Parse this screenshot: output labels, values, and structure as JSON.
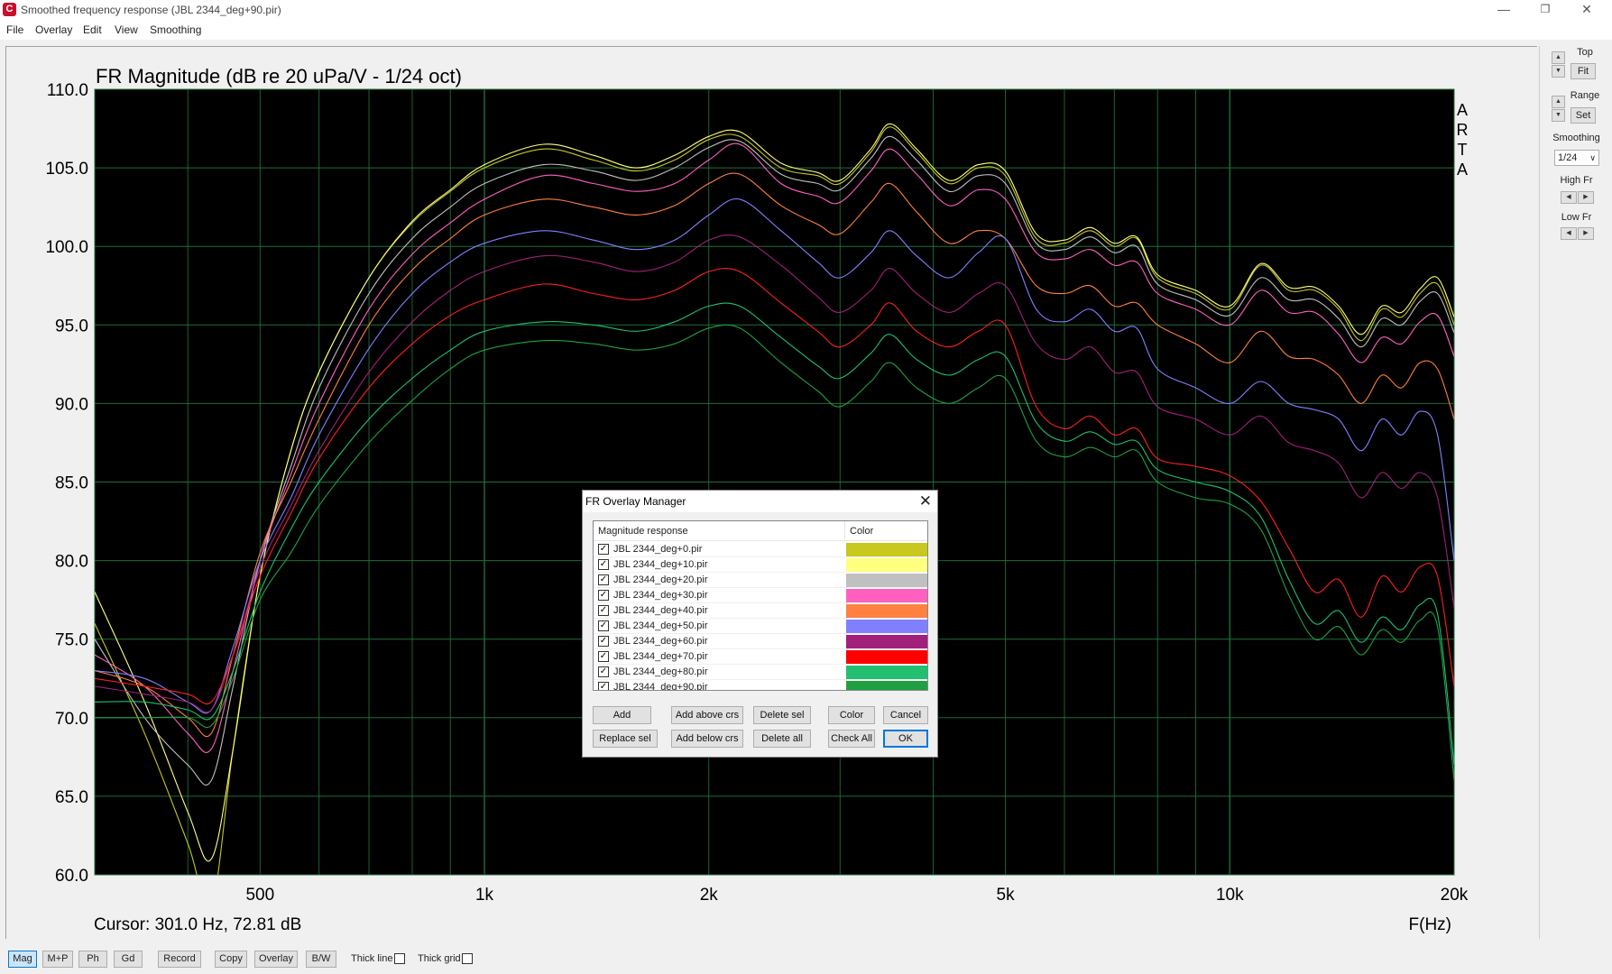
{
  "window": {
    "icon_letter": "C",
    "title": "Smoothed frequency response (JBL 2344_deg+90.pir)",
    "minimize_icon": "minimize-icon",
    "maximize_icon": "restore-icon",
    "close_icon": "close-icon"
  },
  "menu": [
    "File",
    "Overlay",
    "Edit",
    "View",
    "Smoothing"
  ],
  "plot": {
    "title": "FR Magnitude (dB re 20 uPa/V - 1/24 oct)",
    "side_logo": [
      "A",
      "R",
      "T",
      "A"
    ],
    "cursor_readout": "Cursor: 301.0 Hz, 72.81 dB",
    "xlabel": "F(Hz)"
  },
  "chart_data": {
    "type": "line",
    "title": "FR Magnitude (dB re 20 uPa/V - 1/24 oct)",
    "xlabel": "F(Hz)",
    "ylabel": "",
    "x_scale": "log",
    "xlim": [
      300,
      20000
    ],
    "ylim": [
      60,
      110
    ],
    "x_ticks": [
      {
        "value": 500,
        "label": "500"
      },
      {
        "value": 1000,
        "label": "1k"
      },
      {
        "value": 2000,
        "label": "2k"
      },
      {
        "value": 5000,
        "label": "5k"
      },
      {
        "value": 10000,
        "label": "10k"
      },
      {
        "value": 20000,
        "label": "20k"
      }
    ],
    "y_ticks": [
      "110.0",
      "105.0",
      "100.0",
      "95.0",
      "90.0",
      "85.0",
      "80.0",
      "75.0",
      "70.0",
      "65.0",
      "60.0"
    ],
    "grid": true,
    "background": "#000000",
    "grid_color": "#1e6e3a",
    "x": [
      300,
      350,
      400,
      430,
      460,
      500,
      550,
      600,
      700,
      800,
      900,
      1000,
      1200,
      1400,
      1600,
      1800,
      2000,
      2200,
      2500,
      2800,
      3000,
      3300,
      3500,
      3800,
      4200,
      4600,
      5000,
      5500,
      6000,
      6500,
      7000,
      7500,
      8000,
      9000,
      10000,
      11000,
      12000,
      13000,
      14000,
      15000,
      16000,
      17000,
      18000,
      19000,
      20000
    ],
    "series": [
      {
        "name": "JBL 2344_deg+0.pir",
        "color": "#c8c81e",
        "values": [
          76,
          69,
          62,
          58,
          68,
          79,
          87,
          92,
          98,
          101.5,
          103.5,
          105,
          106.2,
          105.5,
          104.8,
          105.5,
          106.8,
          107,
          105,
          104.5,
          104,
          106,
          107.6,
          106,
          104,
          105,
          104.5,
          100.5,
          100.2,
          101,
          100,
          100.5,
          98,
          97,
          96,
          98.8,
          97.2,
          97.2,
          96,
          94,
          96,
          95.5,
          97,
          97.6,
          95
        ]
      },
      {
        "name": "JBL 2344_deg+10.pir",
        "color": "#ffff80",
        "values": [
          78,
          71,
          64,
          61,
          68,
          79,
          87,
          92,
          98,
          101.6,
          103.6,
          105.2,
          106.5,
          105.8,
          105,
          105.8,
          107,
          107.3,
          105.3,
          104.7,
          104.2,
          106.2,
          107.8,
          106.2,
          104.2,
          105.2,
          104.8,
          100.8,
          100.4,
          101.2,
          100.2,
          100.6,
          98.2,
          97.2,
          96.2,
          98.9,
          97.4,
          97.4,
          96.2,
          94.4,
          96.2,
          95.8,
          97.3,
          98,
          95.5
        ]
      },
      {
        "name": "JBL 2344_deg+20.pir",
        "color": "#c0c0c0",
        "values": [
          75,
          70,
          67,
          66,
          72,
          80,
          86,
          91,
          97,
          100.5,
          102.5,
          104,
          105.2,
          104.8,
          104.2,
          105,
          106.3,
          106.7,
          104.6,
          104,
          103.6,
          105.6,
          107,
          105.5,
          103.5,
          104.5,
          104,
          100.2,
          99.8,
          100.6,
          99.6,
          100,
          97.6,
          96.6,
          95.6,
          98,
          96.6,
          96.6,
          95.4,
          93.6,
          95.4,
          95,
          96.5,
          97,
          94.5
        ]
      },
      {
        "name": "JBL 2344_deg+30.pir",
        "color": "#ff60c0",
        "values": [
          74,
          72,
          69,
          68,
          73,
          80,
          85.5,
          90,
          96,
          99.5,
          101.5,
          103,
          104.5,
          104,
          103.5,
          104,
          105.5,
          106.5,
          104,
          103.2,
          102.8,
          104.8,
          106.2,
          104.6,
          102.6,
          103.6,
          103,
          99.6,
          99.2,
          99.8,
          98.8,
          99,
          97,
          96,
          95,
          97.2,
          95.8,
          95.8,
          94.4,
          92.6,
          94.2,
          93.8,
          95.2,
          95.6,
          93
        ]
      },
      {
        "name": "JBL 2344_deg+40.pir",
        "color": "#ff8040",
        "values": [
          73,
          72,
          70,
          69,
          74,
          80.5,
          85,
          89,
          95,
          98.5,
          100.5,
          102,
          103,
          102.5,
          102,
          102.6,
          104,
          104.6,
          102.6,
          101.4,
          100.8,
          102.8,
          104,
          102.2,
          100.2,
          101,
          100.5,
          97.5,
          97,
          97.5,
          96.2,
          96.4,
          95,
          93.8,
          92.6,
          94.6,
          93,
          92.8,
          91.8,
          90,
          91.8,
          91,
          92.6,
          92.2,
          89
        ]
      },
      {
        "name": "JBL 2344_deg+50.pir",
        "color": "#8080ff",
        "values": [
          73,
          72.5,
          71,
          70.5,
          74.5,
          80,
          84,
          88,
          93.5,
          97,
          99,
          100.2,
          101,
          100.4,
          99.8,
          100.4,
          102,
          103,
          101,
          99,
          98,
          99.6,
          101,
          99.4,
          98,
          99.6,
          100.5,
          96,
          95.2,
          96,
          94.6,
          94.8,
          92.2,
          91,
          90,
          91.4,
          90,
          89.6,
          89,
          87,
          89,
          88,
          89.5,
          88,
          80
        ]
      },
      {
        "name": "JBL 2344_deg+60.pir",
        "color": "#a0207a",
        "values": [
          72,
          71.5,
          71,
          70.5,
          74,
          79.5,
          83.5,
          87,
          92,
          95.2,
          97.2,
          98.4,
          99.4,
          99,
          98.4,
          99,
          100.4,
          100.6,
          98.8,
          96.8,
          95.8,
          97.2,
          98.6,
          97,
          95.8,
          97,
          97.5,
          93.8,
          92.8,
          93.6,
          92,
          92,
          89.8,
          89,
          88,
          89.2,
          87.5,
          87,
          86.2,
          84,
          85.6,
          84.6,
          85.6,
          84,
          77
        ]
      },
      {
        "name": "JBL 2344_deg+70.pir",
        "color": "#ff2020",
        "values": [
          72.5,
          72,
          71.5,
          71,
          74,
          79,
          83,
          86.5,
          91,
          93.8,
          95.6,
          96.6,
          97.6,
          97,
          96.6,
          97.2,
          98.4,
          98.4,
          96.4,
          94.6,
          93.6,
          95,
          96.4,
          94.6,
          93.6,
          94.6,
          95,
          89.8,
          88.4,
          89.2,
          88,
          88.4,
          86.5,
          86,
          85.4,
          83.8,
          80.8,
          78,
          78.8,
          76.4,
          79,
          78,
          79.6,
          79,
          72
        ]
      },
      {
        "name": "JBL 2344_deg+80.pir",
        "color": "#20c070",
        "values": [
          71,
          71,
          70.5,
          70,
          73,
          78,
          82,
          85,
          89,
          91.6,
          93.4,
          94.6,
          95.2,
          95,
          94.6,
          95.2,
          96.2,
          96.2,
          94.2,
          92.4,
          91.6,
          93.2,
          94.4,
          92.8,
          91.8,
          92.8,
          93,
          88.8,
          87.6,
          88.2,
          87.4,
          87.6,
          85.8,
          85,
          84.4,
          82.8,
          78.8,
          76,
          76.8,
          74.8,
          76.4,
          75.6,
          77.2,
          76.6,
          67
        ]
      },
      {
        "name": "JBL 2344_deg+90.pir",
        "color": "#20a040",
        "values": [
          70,
          70,
          70,
          69.5,
          72.5,
          77.5,
          80.5,
          83.5,
          87.5,
          90.2,
          92.2,
          93.4,
          94,
          93.8,
          93.4,
          93.8,
          94.8,
          94.8,
          92.6,
          90.8,
          89.8,
          91.4,
          92.6,
          91,
          90,
          91,
          91.6,
          87.6,
          86.6,
          87.2,
          86.6,
          87,
          85,
          84,
          83.6,
          82,
          77.8,
          75,
          75.8,
          74,
          75.6,
          74.8,
          76.2,
          75.8,
          66
        ]
      }
    ]
  },
  "side_panel": {
    "top_label": "Top",
    "fit_label": "Fit",
    "range_label": "Range",
    "set_label": "Set",
    "smoothing_label": "Smoothing",
    "smoothing_value": "1/24",
    "high_fr_label": "High Fr",
    "low_fr_label": "Low Fr"
  },
  "toolbar": {
    "mag": "Mag",
    "mp": "M+P",
    "ph": "Ph",
    "gd": "Gd",
    "record": "Record",
    "copy": "Copy",
    "overlay": "Overlay",
    "bw": "B/W",
    "thick_line": "Thick line",
    "thick_grid": "Thick grid"
  },
  "dialog": {
    "title": "FR Overlay Manager",
    "col_response": "Magnitude response",
    "col_color": "Color",
    "rows": [
      {
        "name": "JBL 2344_deg+0.pir",
        "color": "#c8c81e",
        "checked": true
      },
      {
        "name": "JBL 2344_deg+10.pir",
        "color": "#ffff80",
        "checked": true
      },
      {
        "name": "JBL 2344_deg+20.pir",
        "color": "#c0c0c0",
        "checked": true
      },
      {
        "name": "JBL 2344_deg+30.pir",
        "color": "#ff60c0",
        "checked": true
      },
      {
        "name": "JBL 2344_deg+40.pir",
        "color": "#ff8040",
        "checked": true
      },
      {
        "name": "JBL 2344_deg+50.pir",
        "color": "#8080ff",
        "checked": true
      },
      {
        "name": "JBL 2344_deg+60.pir",
        "color": "#a0207a",
        "checked": true
      },
      {
        "name": "JBL 2344_deg+70.pir",
        "color": "#ff0000",
        "checked": true
      },
      {
        "name": "JBL 2344_deg+80.pir",
        "color": "#20c070",
        "checked": true
      },
      {
        "name": "JBL 2344_deg+90.pir",
        "color": "#20a040",
        "checked": true
      }
    ],
    "buttons": {
      "add": "Add",
      "add_above": "Add above crs",
      "delete_sel": "Delete sel",
      "color": "Color",
      "cancel": "Cancel",
      "replace_sel": "Replace sel",
      "add_below": "Add below crs",
      "delete_all": "Delete all",
      "check_all": "Check All",
      "ok": "OK"
    }
  }
}
